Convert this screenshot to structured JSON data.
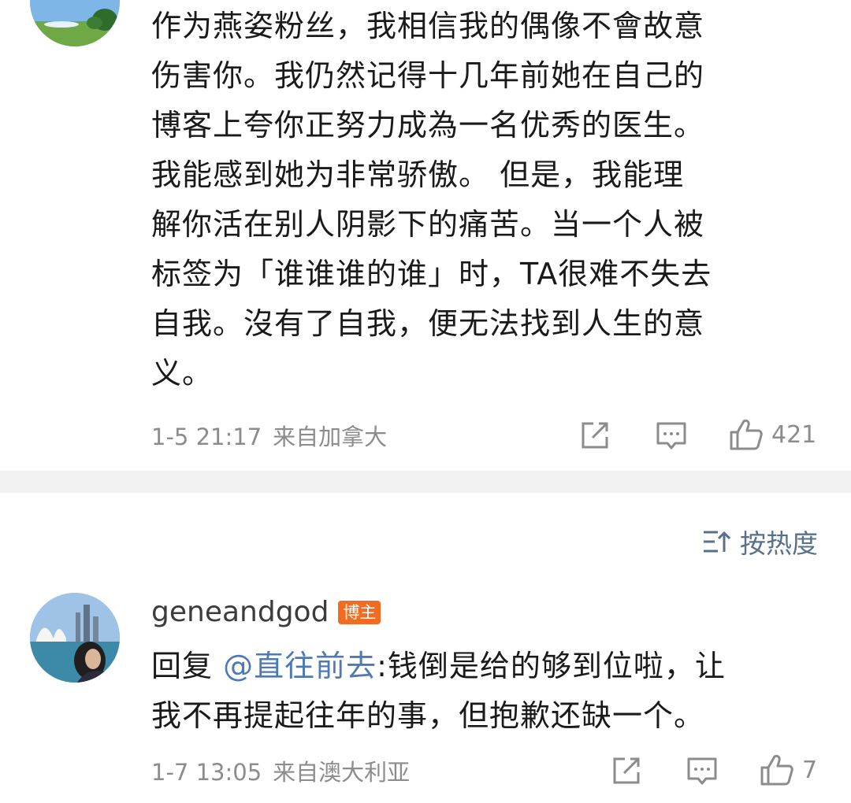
{
  "comment1": {
    "text": "作为燕姿粉丝，我相信我的偶像不會故意\n伤害你。我仍然记得十几年前她在自己的\n博客上夸你正努力成為一名优秀的医生。\n我能感到她为非常骄傲。 但是，我能理\n解你活在别人阴影下的痛苦。当一个人被\n标签为「谁谁谁的谁」时，TA很难不失去\n自我。沒有了自我，便无法找到人生的意\n义。",
    "time": "1-5 21:17",
    "source": "来自加拿大",
    "likes": "421"
  },
  "sort": {
    "label": "按热度"
  },
  "comment2": {
    "username": "geneandgod",
    "badge": "博主",
    "reply_prefix": "回复",
    "mention": "@直往前去",
    "text": ":钱倒是给的够到位啦，让\n我不再提起往年的事，但抱歉还缺一个。",
    "time": "1-7 13:05",
    "source": "来自澳大利亚",
    "likes": "7"
  }
}
